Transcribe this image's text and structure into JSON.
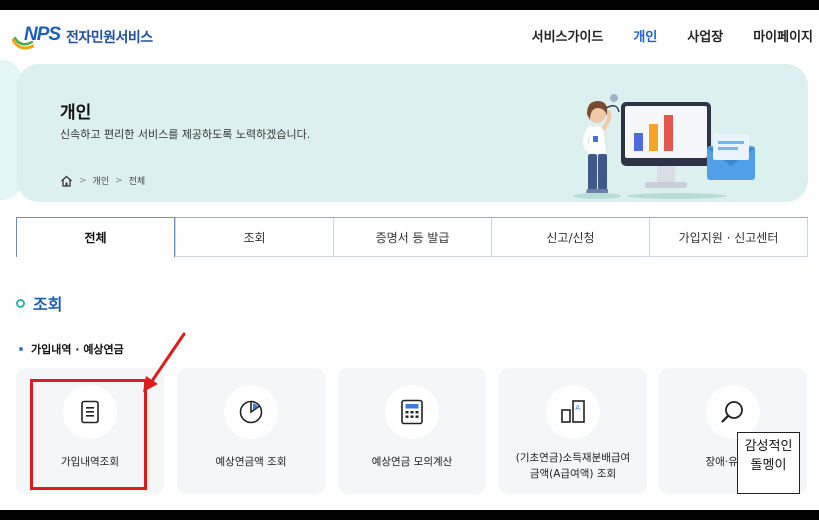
{
  "brand": {
    "logo_mark": "NPS",
    "service_name": "전자민원서비스",
    "accent": "#1a63d8",
    "teal": "#2bb3a3"
  },
  "nav": {
    "items": [
      "서비스가이드",
      "개인",
      "사업장",
      "마이페이지"
    ],
    "active_index": 1
  },
  "hero": {
    "title": "개인",
    "subtitle": "신속하고 편리한 서비스를 제공하도록 노력하겠습니다.",
    "breadcrumb": [
      "개인",
      "전체"
    ],
    "home_icon": "home-icon"
  },
  "tabs": {
    "items": [
      "전체",
      "조회",
      "증명서 등 발급",
      "신고/신청",
      "가입지원 · 신고센터"
    ],
    "active_index": 0
  },
  "section": {
    "title": "조회",
    "subsection": "가입내역 · 예상연금",
    "cards": [
      {
        "label": "가입내역조회",
        "icon": "document-list-icon"
      },
      {
        "label": "예상연금액 조회",
        "icon": "pie-chart-icon"
      },
      {
        "label": "예상연금 모의계산",
        "icon": "calculator-icon"
      },
      {
        "label": "(기초연금)소득재분배급여금액(A급여액) 조회",
        "label_line1": "(기초연금)소득재분배급여",
        "label_line2": "금액(A급여액) 조회",
        "icon": "bar-document-icon"
      },
      {
        "label": "장애·유족 예",
        "icon": "magnifier-icon"
      }
    ]
  },
  "annotation": {
    "highlight_color": "#e01b1b"
  },
  "stamp": {
    "line1": "감성적인",
    "line2": "돌멩이"
  }
}
